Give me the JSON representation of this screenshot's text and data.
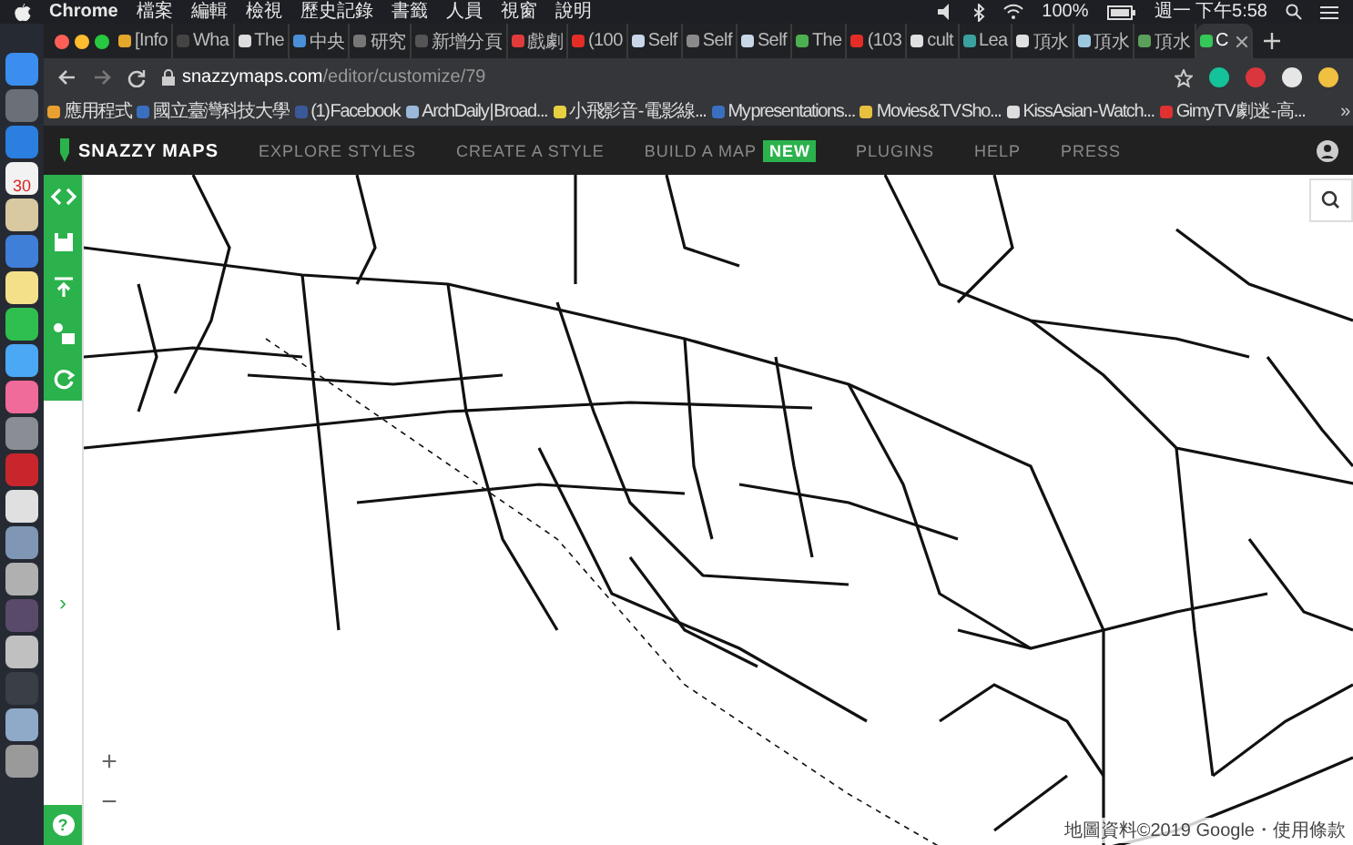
{
  "menu_bar": {
    "app": "Chrome",
    "menus": [
      "檔案",
      "編輯",
      "檢視",
      "歷史記錄",
      "書籤",
      "人員",
      "視窗",
      "說明"
    ],
    "battery": "100%",
    "clock": "週一 下午5:58"
  },
  "dock": {
    "items": [
      {
        "color": "#3b8ef0"
      },
      {
        "color": "#6b6f78"
      },
      {
        "color": "#2a7fe0"
      },
      {
        "color": "#f2f2f2",
        "label": "30"
      },
      {
        "color": "#d8c9a0"
      },
      {
        "color": "#3f7fd8"
      },
      {
        "color": "#f5e08a"
      },
      {
        "color": "#2fbf4f"
      },
      {
        "color": "#4aa8f5"
      },
      {
        "color": "#f06a9a"
      },
      {
        "color": "#8a8d93"
      },
      {
        "color": "#c8262c"
      },
      {
        "color": "#e0e0e0"
      },
      {
        "color": "#7f97b5"
      },
      {
        "color": "#b0b0b0"
      },
      {
        "color": "#5a4a6a"
      },
      {
        "color": "#c0c0c0"
      },
      {
        "color": "#3a3e46"
      },
      {
        "color": "#8fa9c8"
      },
      {
        "color": "#9a9a9a"
      }
    ]
  },
  "tabs": [
    {
      "title": "[Info",
      "color": "#e3a82b",
      "selected": false
    },
    {
      "title": "Wha",
      "color": "#444444",
      "selected": false
    },
    {
      "title": "The",
      "color": "#dddddd",
      "selected": false
    },
    {
      "title": "中央",
      "color": "#4a90d9",
      "selected": false
    },
    {
      "title": "研究",
      "color": "#777777",
      "selected": false
    },
    {
      "title": "新增分頁",
      "color": "#555555",
      "selected": false
    },
    {
      "title": "戲劇",
      "color": "#e23b3b",
      "selected": false
    },
    {
      "title": "(100",
      "color": "#e52d27",
      "selected": false
    },
    {
      "title": "Self",
      "color": "#c9d6e8",
      "selected": false
    },
    {
      "title": "Self",
      "color": "#8a8a8a",
      "selected": false
    },
    {
      "title": "Self",
      "color": "#c9d6e8",
      "selected": false
    },
    {
      "title": "The",
      "color": "#4caf50",
      "selected": false
    },
    {
      "title": "(103",
      "color": "#e52d27",
      "selected": false
    },
    {
      "title": "cult",
      "color": "#e0e0e0",
      "selected": false
    },
    {
      "title": "Lea",
      "color": "#3aa0a0",
      "selected": false
    },
    {
      "title": "頂水",
      "color": "#e0e0e0",
      "selected": false
    },
    {
      "title": "頂水",
      "color": "#9ec8e0",
      "selected": false
    },
    {
      "title": "頂水",
      "color": "#5aa05a",
      "selected": false
    },
    {
      "title": "C",
      "color": "#34c759",
      "selected": true
    }
  ],
  "address_bar": {
    "host": "snazzymaps.com",
    "path": "/editor/customize/79"
  },
  "bookmarks": [
    {
      "title": "應用程式",
      "color": "#e8a030"
    },
    {
      "title": "國立臺灣科技大學",
      "color": "#3a6fc0"
    },
    {
      "title": "(1) Facebook",
      "color": "#3b5998"
    },
    {
      "title": "ArchDaily | Broad...",
      "color": "#9ab8d8"
    },
    {
      "title": "小飛影音 - 電影線...",
      "color": "#e8d040"
    },
    {
      "title": "My presentations...",
      "color": "#3a6fc0"
    },
    {
      "title": "Movies & TV Sho...",
      "color": "#e8c040"
    },
    {
      "title": "KissAsian - Watch...",
      "color": "#dddddd"
    },
    {
      "title": "Gimy TV 劇迷 - 高...",
      "color": "#e03030"
    }
  ],
  "bookmarks_more": "»",
  "site_nav": {
    "logo": "SNAZZY MAPS",
    "links": [
      {
        "label": "EXPLORE STYLES"
      },
      {
        "label": "CREATE A STYLE"
      },
      {
        "label": "BUILD A MAP",
        "badge": "NEW"
      },
      {
        "label": "PLUGINS"
      },
      {
        "label": "HELP"
      },
      {
        "label": "PRESS"
      }
    ]
  },
  "editor_tools": [
    {
      "kind": "code"
    },
    {
      "kind": "save"
    },
    {
      "kind": "upload"
    },
    {
      "kind": "image"
    },
    {
      "kind": "refresh"
    }
  ],
  "expand": "›",
  "help": "?",
  "zoom": [
    "+",
    "−"
  ],
  "map_footer": "地圖資料©2019 Google・使用條款"
}
